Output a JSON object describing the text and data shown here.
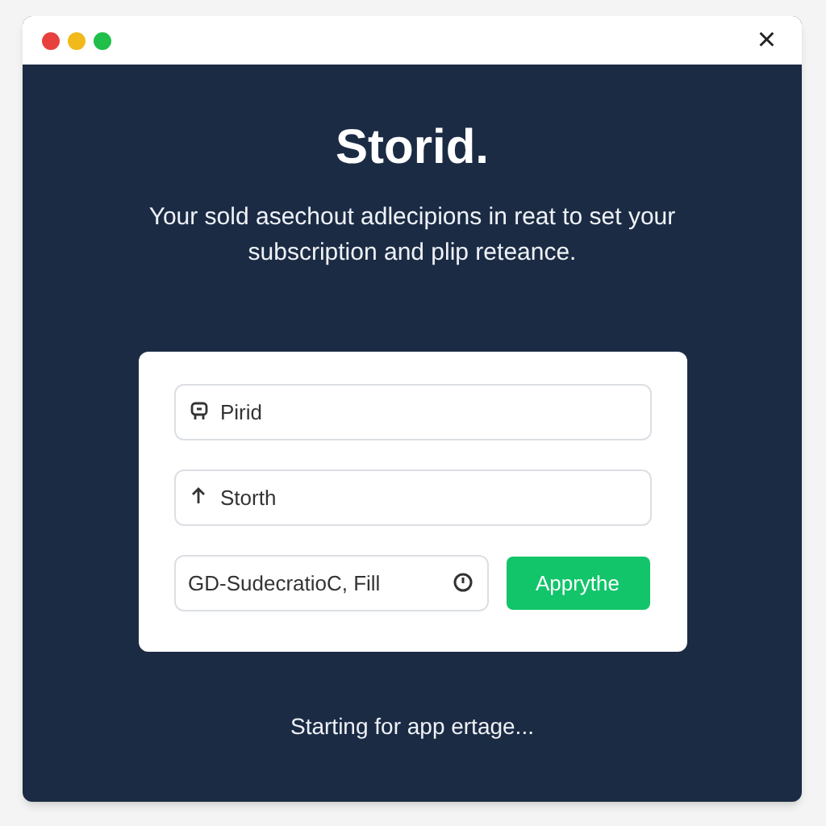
{
  "window": {
    "close": "×"
  },
  "title": "Storid.",
  "subtitle": "Your sold asechout adlecipions in reat to set your subscription and plip reteance.",
  "form": {
    "fields": [
      {
        "kind": "tag",
        "value": "Pirid"
      },
      {
        "kind": "arrow",
        "value": "Storth"
      }
    ],
    "code_field": {
      "value": "GD-SudecratioC, Fill"
    },
    "button": "Apprythe"
  },
  "status": "Starting for app ertage..."
}
